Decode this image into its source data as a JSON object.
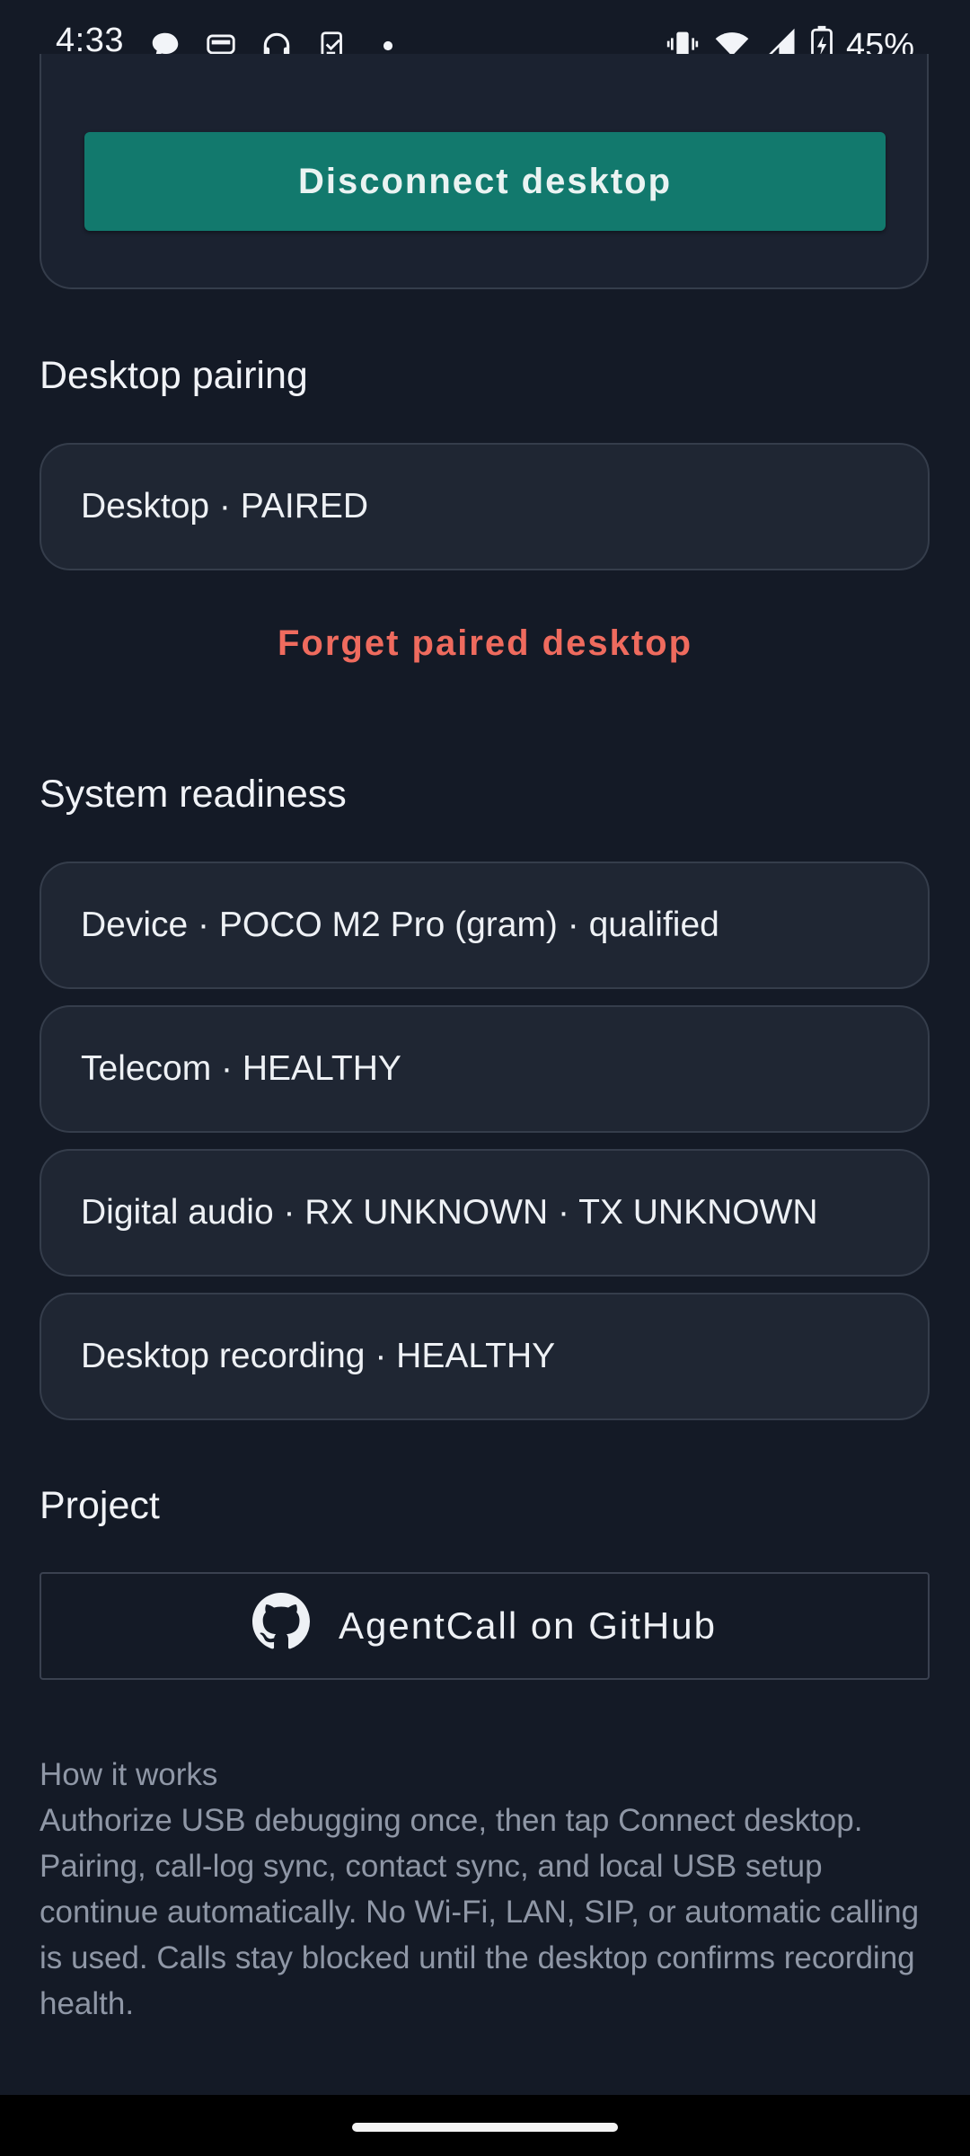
{
  "status_bar": {
    "time": "4:33",
    "battery": "45%",
    "notification_icons": [
      "chat-bubble-icon",
      "bus-icon",
      "headset-icon",
      "clipboard-check-icon",
      "dot-icon"
    ],
    "system_icons": [
      "vibrate-icon",
      "wifi-icon",
      "signal-icon",
      "battery-charging-icon"
    ]
  },
  "connection": {
    "disconnect_button": "Disconnect desktop"
  },
  "pairing": {
    "title": "Desktop pairing",
    "status": "Desktop · PAIRED",
    "forget_link": "Forget paired desktop"
  },
  "readiness": {
    "title": "System readiness",
    "items": [
      "Device · POCO M2 Pro (gram) · qualified",
      "Telecom · HEALTHY",
      "Digital audio · RX UNKNOWN · TX UNKNOWN",
      "Desktop recording · HEALTHY"
    ]
  },
  "project": {
    "title": "Project",
    "github_button": "AgentCall on GitHub",
    "github_icon": "github-icon"
  },
  "how_it_works": {
    "heading": "How it works",
    "body": "Authorize USB debugging once, then tap Connect desktop. Pairing, call-log sync, contact sync, and local USB setup continue automatically. No Wi-Fi, LAN, SIP, or automatic calling is used. Calls stay blocked until the desktop confirms recording health."
  },
  "colors": {
    "background": "#141a26",
    "card": "#1f2633",
    "accent_button": "#12796d",
    "danger_link": "#ef6b5e",
    "muted_text": "#8f97a6"
  }
}
